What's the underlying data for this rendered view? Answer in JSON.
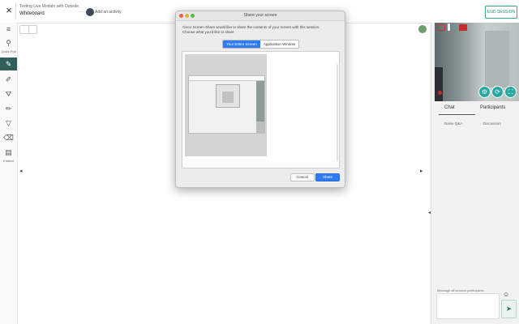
{
  "topbar": {
    "close_glyph": "×",
    "module_title": "Testing Live Module with Outside",
    "module_subtitle": "Whiteboard",
    "dots": "···",
    "add_activity": "Add an activity",
    "end_session": "END SESSION"
  },
  "rail": {
    "tools": [
      {
        "icon": "menu-icon",
        "glyph": "≡"
      },
      {
        "icon": "quick-poll-icon",
        "glyph": "⚲",
        "label": "Quick Poll"
      },
      {
        "icon": "pen-icon",
        "glyph": "✎"
      },
      {
        "icon": "brush-icon",
        "glyph": "✐"
      },
      {
        "icon": "fill-icon",
        "glyph": "⛛"
      },
      {
        "icon": "highlighter-icon",
        "glyph": "✏"
      },
      {
        "icon": "shape-icon",
        "glyph": "▽"
      },
      {
        "icon": "eraser-icon",
        "glyph": "⌫"
      },
      {
        "icon": "embed-icon",
        "glyph": "▤",
        "label": "Embed"
      }
    ]
  },
  "canvas": {
    "left_arrow": "◂",
    "right_arrow": "▸"
  },
  "video": {
    "controls": [
      "gear-icon",
      "share-screen-icon",
      "fullscreen-icon"
    ],
    "control_glyphs": [
      "⚙",
      "⟳",
      "⛶"
    ]
  },
  "sidepanel": {
    "tab_chat": "Chat",
    "tab_participants": "Participants",
    "sub_a": "Raise Q&A",
    "sub_b": "Discussion",
    "chat_hint": "Message all session participants",
    "emoji": "☺",
    "send_glyph": "➤",
    "collapse_glyph": "◂"
  },
  "dialog": {
    "title": "Share your screen",
    "message_line1": "Cisco Screen Share would like to share the contents of your screen with this session.",
    "message_line2": "Choose what you'd like to share",
    "tab_entire": "Your Entire Screen",
    "tab_window": "Application Window",
    "cancel": "Cancel",
    "share": "Share"
  },
  "colors": {
    "accent": "#2f5f5a",
    "dialog_blue": "#2f7bf3",
    "record_red": "#c62a2a",
    "teal_control": "#2aa8a0"
  }
}
